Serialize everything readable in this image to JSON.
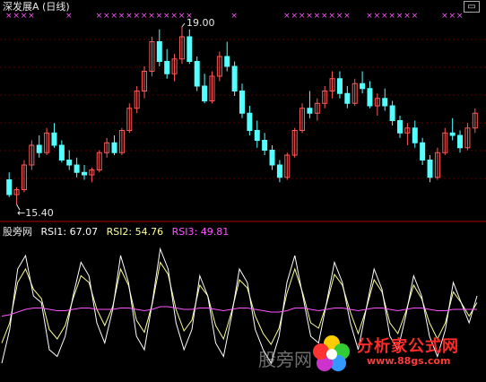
{
  "header": {
    "title": "深发展A (日线)",
    "high_marker": "19.00",
    "low_marker": "15.40",
    "window_icon": "▭"
  },
  "indicator": {
    "name": "股旁网",
    "rsi1_label": "RSI1: 67.07",
    "rsi2_label": "RSI2: 54.76",
    "rsi3_label": "RSI3: 49.81"
  },
  "watermark": {
    "site_name": "分析家公式网",
    "url": "www.88gs.com",
    "stamp_text": "股旁网"
  },
  "colors": {
    "up_candle": "#ff5a5a",
    "down_candle": "#54ffff",
    "rsi1": "#ffffff",
    "rsi2": "#ffff99",
    "rsi3": "#ff55ff",
    "divider": "#b00000",
    "signal": "#ff55ff"
  },
  "chart_data": {
    "type": "candlestick",
    "panes": [
      "price",
      "rsi"
    ],
    "price_range": [
      15.4,
      19.0
    ],
    "ohlc": [
      [
        15.9,
        16.05,
        15.55,
        15.6
      ],
      [
        15.6,
        15.75,
        15.4,
        15.7
      ],
      [
        15.7,
        16.3,
        15.65,
        16.2
      ],
      [
        16.2,
        16.7,
        16.1,
        16.6
      ],
      [
        16.6,
        16.8,
        16.35,
        16.45
      ],
      [
        16.45,
        16.95,
        16.4,
        16.85
      ],
      [
        16.85,
        17.05,
        16.55,
        16.6
      ],
      [
        16.6,
        16.7,
        16.25,
        16.3
      ],
      [
        16.3,
        16.5,
        16.1,
        16.2
      ],
      [
        16.2,
        16.35,
        15.95,
        16.05
      ],
      [
        16.05,
        16.2,
        15.9,
        16.0
      ],
      [
        16.0,
        16.15,
        15.85,
        16.1
      ],
      [
        16.1,
        16.5,
        16.05,
        16.45
      ],
      [
        16.45,
        16.75,
        16.35,
        16.65
      ],
      [
        16.65,
        16.8,
        16.4,
        16.45
      ],
      [
        16.45,
        16.95,
        16.4,
        16.9
      ],
      [
        16.9,
        17.45,
        16.85,
        17.35
      ],
      [
        17.35,
        17.8,
        17.25,
        17.7
      ],
      [
        17.7,
        18.2,
        17.55,
        18.1
      ],
      [
        18.1,
        18.8,
        18.0,
        18.7
      ],
      [
        18.7,
        18.95,
        18.2,
        18.3
      ],
      [
        18.3,
        18.55,
        17.95,
        18.05
      ],
      [
        18.05,
        18.45,
        17.9,
        18.35
      ],
      [
        18.35,
        19.0,
        18.25,
        18.8
      ],
      [
        18.8,
        18.95,
        18.25,
        18.3
      ],
      [
        18.3,
        18.4,
        17.7,
        17.8
      ],
      [
        17.8,
        18.05,
        17.45,
        17.5
      ],
      [
        17.5,
        18.1,
        17.45,
        18.0
      ],
      [
        18.0,
        18.5,
        17.9,
        18.4
      ],
      [
        18.4,
        18.7,
        18.1,
        18.2
      ],
      [
        18.2,
        18.3,
        17.6,
        17.7
      ],
      [
        17.7,
        17.85,
        17.15,
        17.25
      ],
      [
        17.25,
        17.4,
        16.8,
        16.9
      ],
      [
        16.9,
        17.1,
        16.55,
        16.7
      ],
      [
        16.7,
        16.85,
        16.4,
        16.5
      ],
      [
        16.5,
        16.6,
        16.1,
        16.2
      ],
      [
        16.2,
        16.3,
        15.85,
        15.95
      ],
      [
        15.95,
        16.45,
        15.9,
        16.4
      ],
      [
        16.4,
        16.95,
        16.35,
        16.9
      ],
      [
        16.9,
        17.45,
        16.85,
        17.35
      ],
      [
        17.35,
        17.7,
        17.15,
        17.25
      ],
      [
        17.25,
        17.55,
        17.1,
        17.45
      ],
      [
        17.45,
        17.8,
        17.35,
        17.7
      ],
      [
        17.7,
        18.1,
        17.55,
        17.95
      ],
      [
        17.95,
        18.1,
        17.55,
        17.65
      ],
      [
        17.65,
        17.8,
        17.35,
        17.45
      ],
      [
        17.45,
        17.95,
        17.4,
        17.85
      ],
      [
        17.85,
        18.1,
        17.65,
        17.75
      ],
      [
        17.75,
        17.9,
        17.35,
        17.4
      ],
      [
        17.4,
        17.65,
        17.2,
        17.55
      ],
      [
        17.55,
        17.75,
        17.3,
        17.4
      ],
      [
        17.4,
        17.5,
        17.0,
        17.1
      ],
      [
        17.1,
        17.2,
        16.75,
        16.85
      ],
      [
        16.85,
        17.05,
        16.6,
        16.95
      ],
      [
        16.95,
        17.1,
        16.55,
        16.65
      ],
      [
        16.65,
        16.75,
        16.2,
        16.3
      ],
      [
        16.3,
        16.4,
        15.85,
        15.95
      ],
      [
        15.95,
        16.55,
        15.9,
        16.45
      ],
      [
        16.45,
        16.95,
        16.4,
        16.85
      ],
      [
        16.85,
        17.15,
        16.7,
        16.8
      ],
      [
        16.8,
        16.9,
        16.45,
        16.55
      ],
      [
        16.55,
        17.05,
        16.5,
        16.95
      ],
      [
        16.95,
        17.35,
        16.85,
        17.25
      ]
    ],
    "rsi1": [
      10,
      35,
      80,
      90,
      60,
      55,
      20,
      15,
      30,
      60,
      85,
      75,
      40,
      25,
      50,
      90,
      70,
      30,
      20,
      55,
      95,
      80,
      40,
      20,
      35,
      75,
      60,
      25,
      15,
      45,
      80,
      70,
      35,
      20,
      10,
      30,
      70,
      90,
      60,
      30,
      25,
      55,
      85,
      70,
      40,
      20,
      50,
      80,
      65,
      30,
      20,
      45,
      75,
      60,
      30,
      15,
      35,
      70,
      55,
      40,
      60
    ],
    "rsi2": [
      25,
      40,
      70,
      80,
      65,
      58,
      35,
      28,
      38,
      58,
      75,
      70,
      50,
      38,
      52,
      80,
      68,
      42,
      33,
      54,
      85,
      76,
      50,
      34,
      42,
      68,
      60,
      38,
      28,
      48,
      72,
      66,
      45,
      32,
      24,
      36,
      62,
      80,
      62,
      40,
      36,
      54,
      76,
      68,
      48,
      32,
      50,
      72,
      63,
      40,
      32,
      48,
      68,
      58,
      40,
      28,
      40,
      63,
      55,
      45,
      55
    ],
    "rsi3": [
      45,
      46,
      48,
      50,
      51,
      51,
      50,
      49,
      49,
      50,
      51,
      51,
      50,
      50,
      50,
      51,
      51,
      50,
      49,
      50,
      52,
      52,
      51,
      50,
      50,
      51,
      51,
      50,
      49,
      50,
      51,
      51,
      50,
      49,
      48,
      48,
      49,
      51,
      51,
      50,
      49,
      50,
      51,
      51,
      50,
      49,
      50,
      51,
      51,
      50,
      49,
      50,
      51,
      51,
      50,
      49,
      49,
      50,
      50,
      50,
      50
    ]
  }
}
